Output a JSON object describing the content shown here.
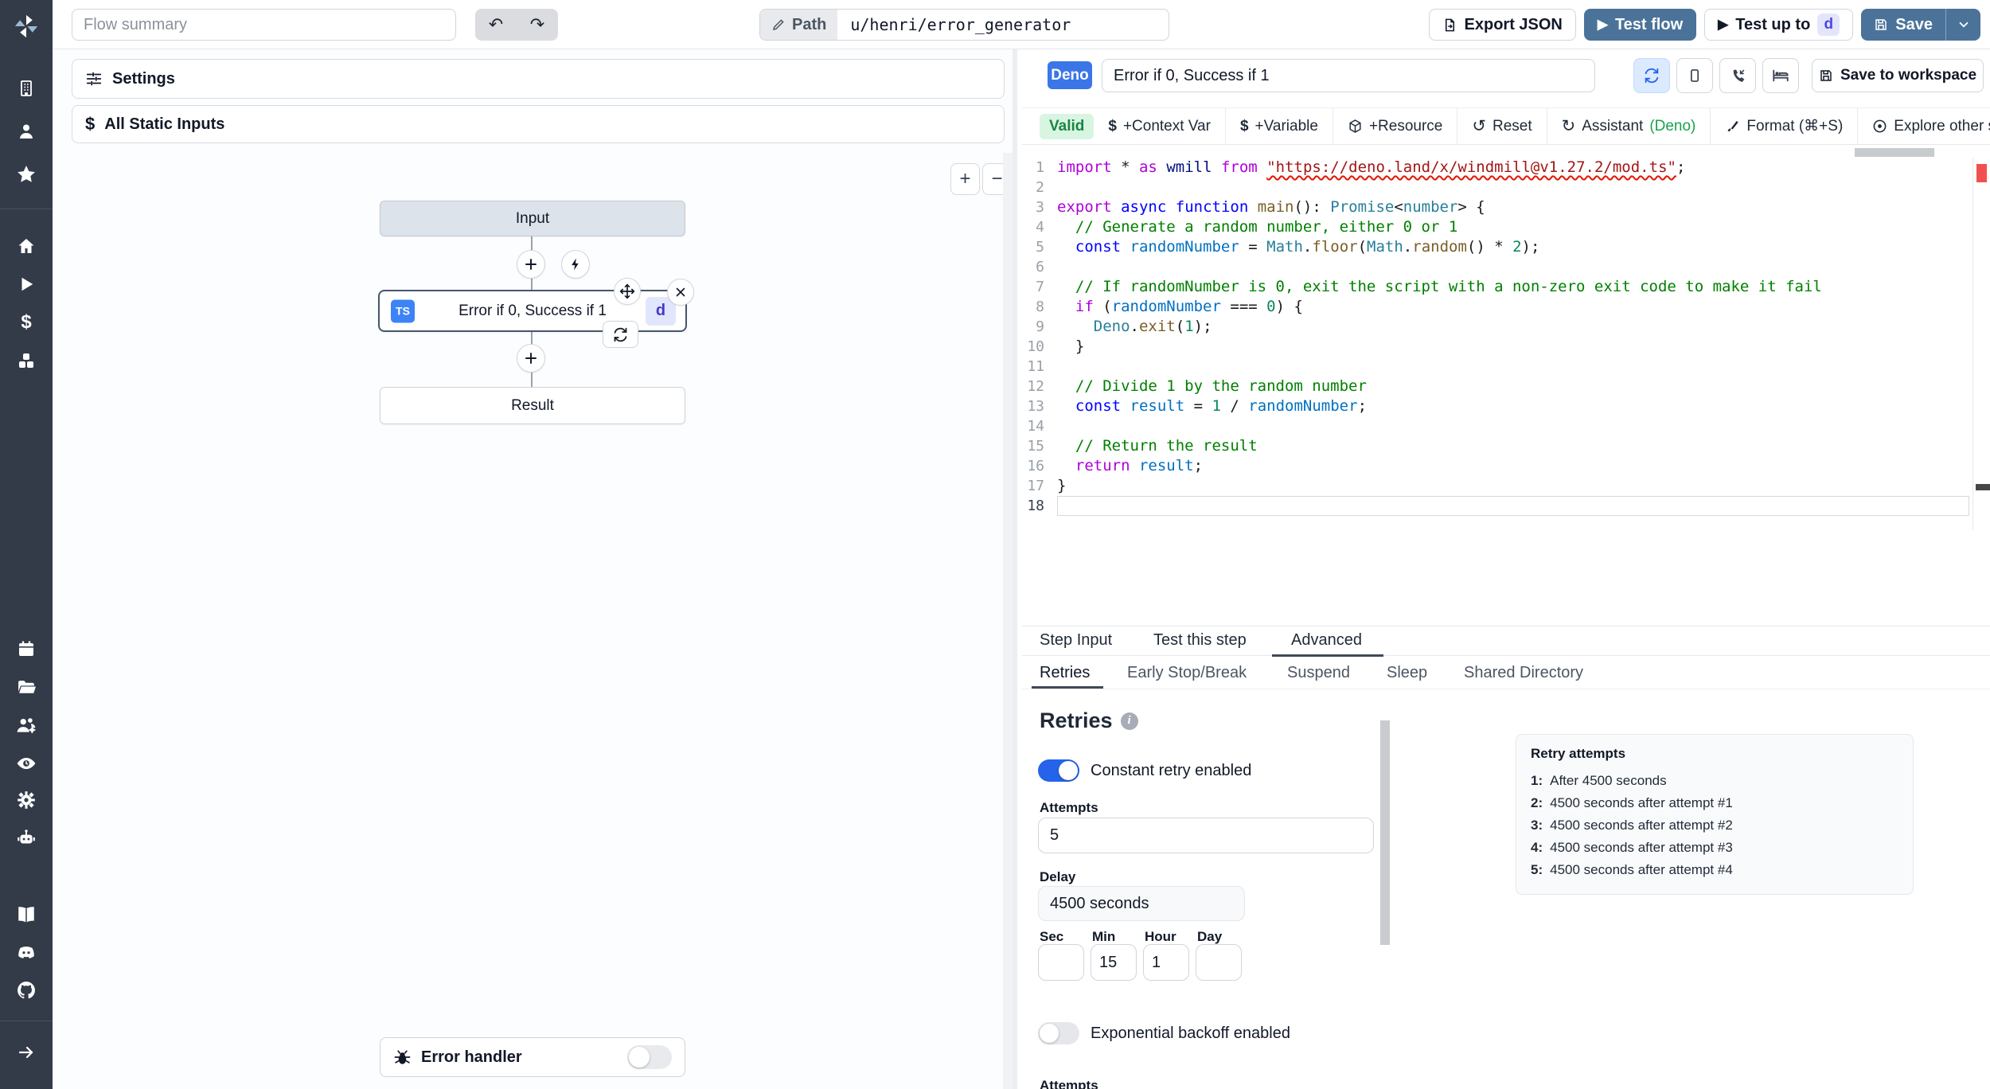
{
  "colors": {
    "primary_button": "#4b7399",
    "accent_blue": "#2563eb",
    "valid_green": "#188544",
    "sidebar_bg": "#333a48"
  },
  "topbar": {
    "flow_summary_placeholder": "Flow summary",
    "path_label": "Path",
    "path_value": "u/henri/error_generator",
    "export_json_label": "Export JSON",
    "test_flow_label": "Test flow",
    "test_up_to_label": "Test up to",
    "test_up_to_badge": "d",
    "save_label": "Save"
  },
  "sidebar": {
    "icons": [
      "windmill-logo",
      "building",
      "user",
      "star",
      "home",
      "play",
      "dollar",
      "cubes",
      "calendar",
      "folder-open",
      "user-group",
      "eye",
      "gear",
      "robot",
      "book",
      "discord",
      "github",
      "arrow-right"
    ],
    "dollar_glyph": "$"
  },
  "flow": {
    "settings_label": "Settings",
    "static_inputs_label": "All Static Inputs",
    "zoom_in": "+",
    "zoom_out": "−",
    "input_node_label": "Input",
    "main_node": {
      "lang_badge": "TS",
      "label": "Error if 0, Success if 1",
      "suffix_badge": "d"
    },
    "result_node_label": "Result",
    "error_handler_label": "Error handler"
  },
  "editor": {
    "lang_badge": "Deno",
    "step_name": "Error if 0, Success if 1",
    "save_to_workspace_label": "Save to workspace",
    "toolbar": {
      "valid": "Valid",
      "context_var": "+Context Var",
      "variable": "+Variable",
      "resource": "+Resource",
      "reset": "Reset",
      "assistant": "Assistant",
      "assistant_lang": "(Deno)",
      "format": "Format (⌘+S)",
      "explore": "Explore other s"
    },
    "code_lines": [
      [
        [
          "k",
          "import"
        ],
        [
          "p",
          " * "
        ],
        [
          "k",
          "as"
        ],
        [
          "p",
          " "
        ],
        [
          "v",
          "wmill"
        ],
        [
          "p",
          " "
        ],
        [
          "k",
          "from"
        ],
        [
          "p",
          " "
        ],
        [
          "sq",
          "\"https://deno.land/x/windmill@v1.27.2/mod.ts\""
        ],
        [
          "p",
          ";"
        ]
      ],
      [],
      [
        [
          "k",
          "export"
        ],
        [
          "p",
          " "
        ],
        [
          "b",
          "async"
        ],
        [
          "p",
          " "
        ],
        [
          "b",
          "function"
        ],
        [
          "p",
          " "
        ],
        [
          "f",
          "main"
        ],
        [
          "p",
          "(): "
        ],
        [
          "t",
          "Promise"
        ],
        [
          "p",
          "<"
        ],
        [
          "t",
          "number"
        ],
        [
          "p",
          "> {"
        ]
      ],
      [
        [
          "c",
          "  // Generate a random number, either 0 or 1"
        ]
      ],
      [
        [
          "p",
          "  "
        ],
        [
          "b",
          "const"
        ],
        [
          "p",
          " "
        ],
        [
          "vc",
          "randomNumber"
        ],
        [
          "p",
          " = "
        ],
        [
          "t",
          "Math"
        ],
        [
          "p",
          "."
        ],
        [
          "f",
          "floor"
        ],
        [
          "p",
          "("
        ],
        [
          "t",
          "Math"
        ],
        [
          "p",
          "."
        ],
        [
          "f",
          "random"
        ],
        [
          "p",
          "() * "
        ],
        [
          "n",
          "2"
        ],
        [
          "p",
          ");"
        ]
      ],
      [],
      [
        [
          "c",
          "  // If randomNumber is 0, exit the script with a non-zero exit code to make it fail"
        ]
      ],
      [
        [
          "p",
          "  "
        ],
        [
          "k",
          "if"
        ],
        [
          "p",
          " ("
        ],
        [
          "vc",
          "randomNumber"
        ],
        [
          "p",
          " === "
        ],
        [
          "n",
          "0"
        ],
        [
          "p",
          ") {"
        ]
      ],
      [
        [
          "p",
          "    "
        ],
        [
          "t",
          "Deno"
        ],
        [
          "p",
          "."
        ],
        [
          "f",
          "exit"
        ],
        [
          "p",
          "("
        ],
        [
          "n",
          "1"
        ],
        [
          "p",
          ");"
        ]
      ],
      [
        [
          "p",
          "  }"
        ]
      ],
      [],
      [
        [
          "c",
          "  // Divide 1 by the random number"
        ]
      ],
      [
        [
          "p",
          "  "
        ],
        [
          "b",
          "const"
        ],
        [
          "p",
          " "
        ],
        [
          "vc",
          "result"
        ],
        [
          "p",
          " = "
        ],
        [
          "n",
          "1"
        ],
        [
          "p",
          " / "
        ],
        [
          "vc",
          "randomNumber"
        ],
        [
          "p",
          ";"
        ]
      ],
      [],
      [
        [
          "c",
          "  // Return the result"
        ]
      ],
      [
        [
          "p",
          "  "
        ],
        [
          "k",
          "return"
        ],
        [
          "p",
          " "
        ],
        [
          "vc",
          "result"
        ],
        [
          "p",
          ";"
        ]
      ],
      [
        [
          "p",
          "}"
        ]
      ],
      []
    ]
  },
  "tabs": {
    "step_input": "Step Input",
    "test_this_step": "Test this step",
    "advanced": "Advanced"
  },
  "subtabs": [
    "Retries",
    "Early Stop/Break",
    "Suspend",
    "Sleep",
    "Shared Directory"
  ],
  "retries": {
    "title": "Retries",
    "constant_toggle_label": "Constant retry enabled",
    "attempts_label": "Attempts",
    "attempts_value": "5",
    "delay_label": "Delay",
    "delay_value": "4500 seconds",
    "time_fields": [
      {
        "label": "Sec",
        "value": ""
      },
      {
        "label": "Min",
        "value": "15"
      },
      {
        "label": "Hour",
        "value": "1"
      },
      {
        "label": "Day",
        "value": ""
      }
    ],
    "exponential_toggle_label": "Exponential backoff enabled",
    "clipped_label": "Attempts",
    "panel": {
      "title": "Retry attempts",
      "items": [
        {
          "n": "1:",
          "text": "After 4500 seconds"
        },
        {
          "n": "2:",
          "text": "4500 seconds after attempt #1"
        },
        {
          "n": "3:",
          "text": "4500 seconds after attempt #2"
        },
        {
          "n": "4:",
          "text": "4500 seconds after attempt #3"
        },
        {
          "n": "5:",
          "text": "4500 seconds after attempt #4"
        }
      ]
    }
  }
}
